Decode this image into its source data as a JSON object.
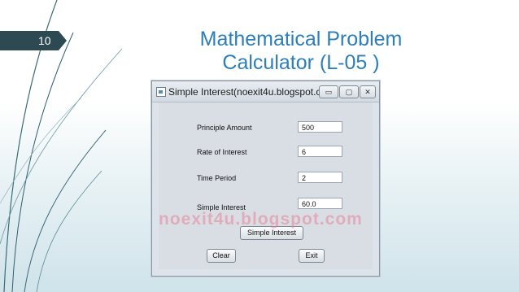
{
  "slide": {
    "number": "10",
    "title_line1": "Mathematical Problem",
    "title_line2": "Calculator (L-05 )"
  },
  "window": {
    "title": "Simple Interest(noexit4u.blogspot.co...",
    "minimize_icon": "minimize-icon",
    "maximize_icon": "maximize-icon",
    "close_icon": "close-icon"
  },
  "form": {
    "principle_label": "Principle Amount",
    "principle_value": "500",
    "rate_label": "Rate of Interest",
    "rate_value": "6",
    "time_label": "Time Period",
    "time_value": "2",
    "si_label": "Simple Interest",
    "si_value": "60.0",
    "calc_button": "Simple Interest",
    "clear_button": "Clear",
    "exit_button": "Exit"
  },
  "watermark": "noexit4u.blogspot.com",
  "colors": {
    "title": "#2c7fb8",
    "slide_band": "#2d4a52",
    "watermark": "#e88498"
  }
}
